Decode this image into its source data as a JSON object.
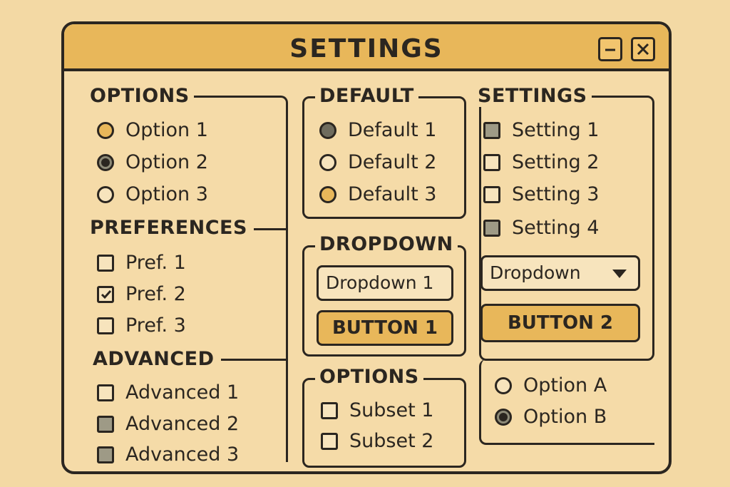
{
  "window": {
    "title": "SETTINGS"
  },
  "groups": {
    "options": {
      "heading": "OPTIONS",
      "items": [
        "Option 1",
        "Option 2",
        "Option 3"
      ]
    },
    "preferences": {
      "heading": "PREFERENCES",
      "items": [
        "Pref. 1",
        "Pref. 2",
        "Pref. 3"
      ]
    },
    "advanced": {
      "heading": "ADVANCED",
      "items": [
        "Advanced 1",
        "Advanced 2",
        "Advanced 3"
      ]
    },
    "default": {
      "heading": "DEFAULT",
      "items": [
        "Default 1",
        "Default 2",
        "Default 3"
      ]
    },
    "dropdown": {
      "heading": "DROPDOWN",
      "value": "Dropdown 1",
      "button": "BUTTON 1"
    },
    "subset": {
      "heading": "OPTIONS",
      "items": [
        "Subset 1",
        "Subset 2"
      ]
    },
    "settings": {
      "heading": "SETTINGS",
      "items": [
        "Setting 1",
        "Setting 2",
        "Setting 3",
        "Setting 4"
      ],
      "dropdown": "Dropdown",
      "button": "BUTTON 2"
    },
    "radio_ab": {
      "items": [
        "Option A",
        "Option B"
      ]
    }
  },
  "colors": {
    "background": "#f3d9a4",
    "accent": "#e8b75a",
    "ink": "#2b2620",
    "fill_gray": "#9e9a86"
  },
  "icons": {
    "minimize": "minimize-icon",
    "close": "close-icon",
    "caret": "chevron-down-icon",
    "check": "checkmark-icon"
  }
}
